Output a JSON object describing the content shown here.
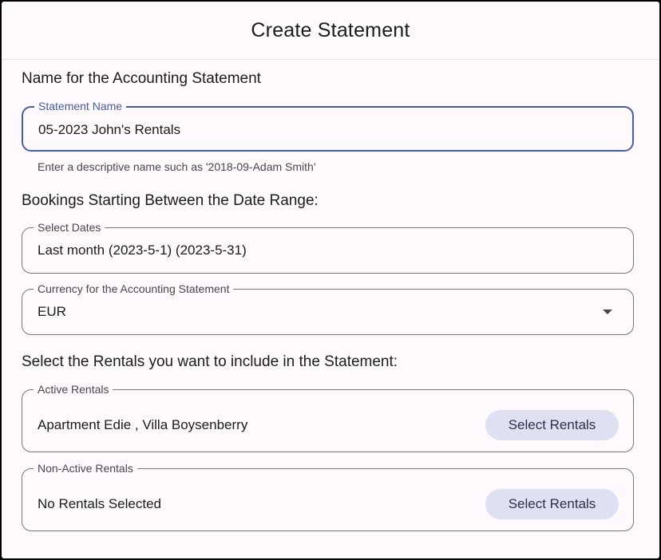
{
  "dialog": {
    "title": "Create Statement"
  },
  "name_section": {
    "heading": "Name for the Accounting Statement",
    "statement_name": {
      "label": "Statement Name",
      "value": "05-2023 John's Rentals",
      "helper": "Enter a descriptive name such as '2018-09-Adam Smith'"
    }
  },
  "date_section": {
    "heading": "Bookings Starting Between the Date Range:",
    "select_dates": {
      "label": "Select Dates",
      "value": "Last month (2023-5-1) (2023-5-31)"
    },
    "currency": {
      "label": "Currency for the Accounting Statement",
      "value": "EUR",
      "icon": "chevron-down-icon"
    }
  },
  "rentals_section": {
    "heading": "Select the Rentals you want to include in the Statement:",
    "active": {
      "label": "Active Rentals",
      "value": "Apartment Edie , Villa Boysenberry",
      "button_label": "Select Rentals"
    },
    "non_active": {
      "label": "Non-Active Rentals",
      "value": "No Rentals Selected",
      "button_label": "Select Rentals"
    }
  },
  "colors": {
    "background": "#fdf9fd",
    "focus_accent": "#4a5d9e",
    "outline": "#79757f",
    "tonal_button": "#dfe1f3"
  }
}
